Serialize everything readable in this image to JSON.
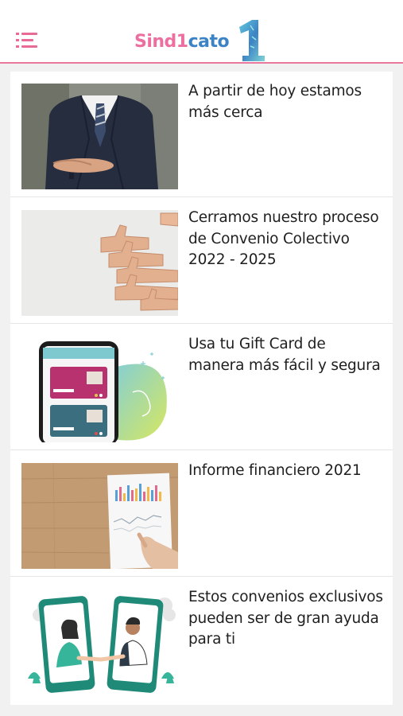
{
  "header": {
    "menu_icon": "hamburger-menu-icon",
    "logo": {
      "part1": "Sind",
      "part2": "1",
      "part3": "cato",
      "big_numeral": "1"
    },
    "brand_pink": "#e9799c",
    "brand_blue": "#3b83c4"
  },
  "articles": [
    {
      "title": "A partir de hoy estamos más cerca",
      "image": "businessman-offering-hand"
    },
    {
      "title": "Cerramos nuestro proceso de Convenio Colectivo 2022 - 2025",
      "image": "thumbs-up-hands"
    },
    {
      "title": "Usa tu Gift Card  de manera más fácil y segura",
      "image": "phone-gift-card-app"
    },
    {
      "title": "Informe financiero 2021",
      "image": "financial-report-chart"
    },
    {
      "title": "Estos convenios exclusivos pueden ser de gran ayuda para ti",
      "image": "phones-handshake-illustration"
    }
  ]
}
